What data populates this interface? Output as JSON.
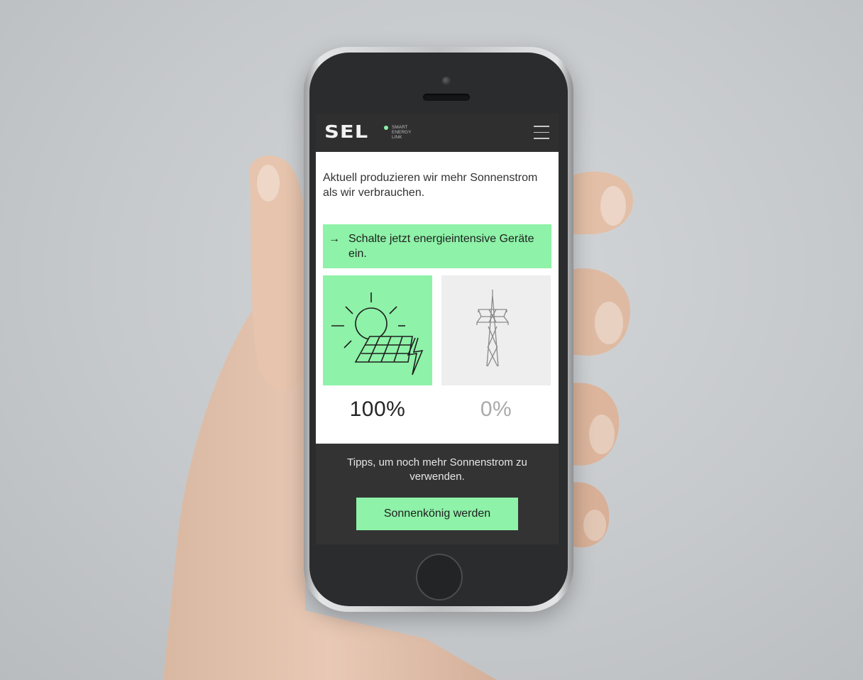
{
  "brand": {
    "logo": "SEL",
    "tagline_lines": [
      "SMART",
      "ENERGY",
      "LINK"
    ],
    "accent_color": "#8ef2a8"
  },
  "header": {
    "menu_icon": "hamburger-menu-icon"
  },
  "main": {
    "intro": "Aktuell produzieren wir mehr Sonnenstrom als wir verbrauchen.",
    "cta": {
      "arrow": "→",
      "text": "Schalte jetzt energieintensive Geräte ein."
    },
    "sources": [
      {
        "icon": "sun-solar-panel-icon",
        "percent": "100%",
        "active": true
      },
      {
        "icon": "power-pylon-icon",
        "percent": "0%",
        "active": false
      }
    ]
  },
  "footer": {
    "tip": "Tipps, um noch mehr Sonnenstrom zu verwenden.",
    "button_label": "Sonnenkönig werden"
  },
  "device": {
    "type": "smartphone",
    "frame_color": "#2b2c2d"
  }
}
